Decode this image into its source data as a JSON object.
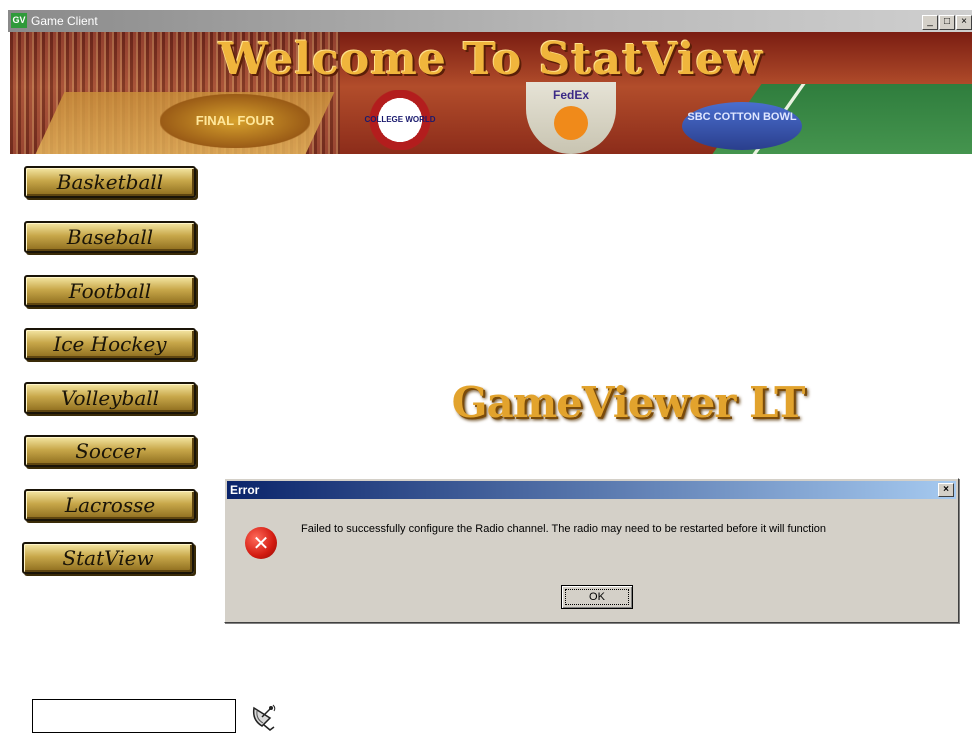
{
  "window": {
    "app_icon": "GV",
    "title": "Game Client",
    "controls": {
      "minimize": "_",
      "maximize": "□",
      "close": "×"
    }
  },
  "banner": {
    "headline": "Welcome To StatView",
    "logos": {
      "final_four": "FINAL FOUR",
      "world_series": "COLLEGE WORLD SERIES",
      "orange_bowl": "FedEx",
      "cotton_bowl": "SBC COTTON BOWL"
    }
  },
  "nav": {
    "items": [
      {
        "label": "Basketball"
      },
      {
        "label": "Baseball"
      },
      {
        "label": "Football"
      },
      {
        "label": "Ice Hockey"
      },
      {
        "label": "Volleyball"
      },
      {
        "label": "Soccer"
      },
      {
        "label": "Lacrosse"
      },
      {
        "label": "StatView"
      }
    ]
  },
  "main": {
    "brand": "GameViewer LT"
  },
  "dialog": {
    "title": "Error",
    "close_label": "×",
    "icon": "error-x-icon",
    "icon_glyph": "✕",
    "message": "Failed to successfully configure the Radio channel. The radio may need to be restarted before it will function",
    "ok_label": "OK"
  },
  "footer": {
    "input_value": "",
    "icon": "satellite-dish-icon"
  },
  "colors": {
    "accent_gold": "#e2a32d",
    "dialog_title_start": "#0a246a",
    "dialog_title_end": "#a6caf0",
    "error_red": "#d21a10"
  }
}
